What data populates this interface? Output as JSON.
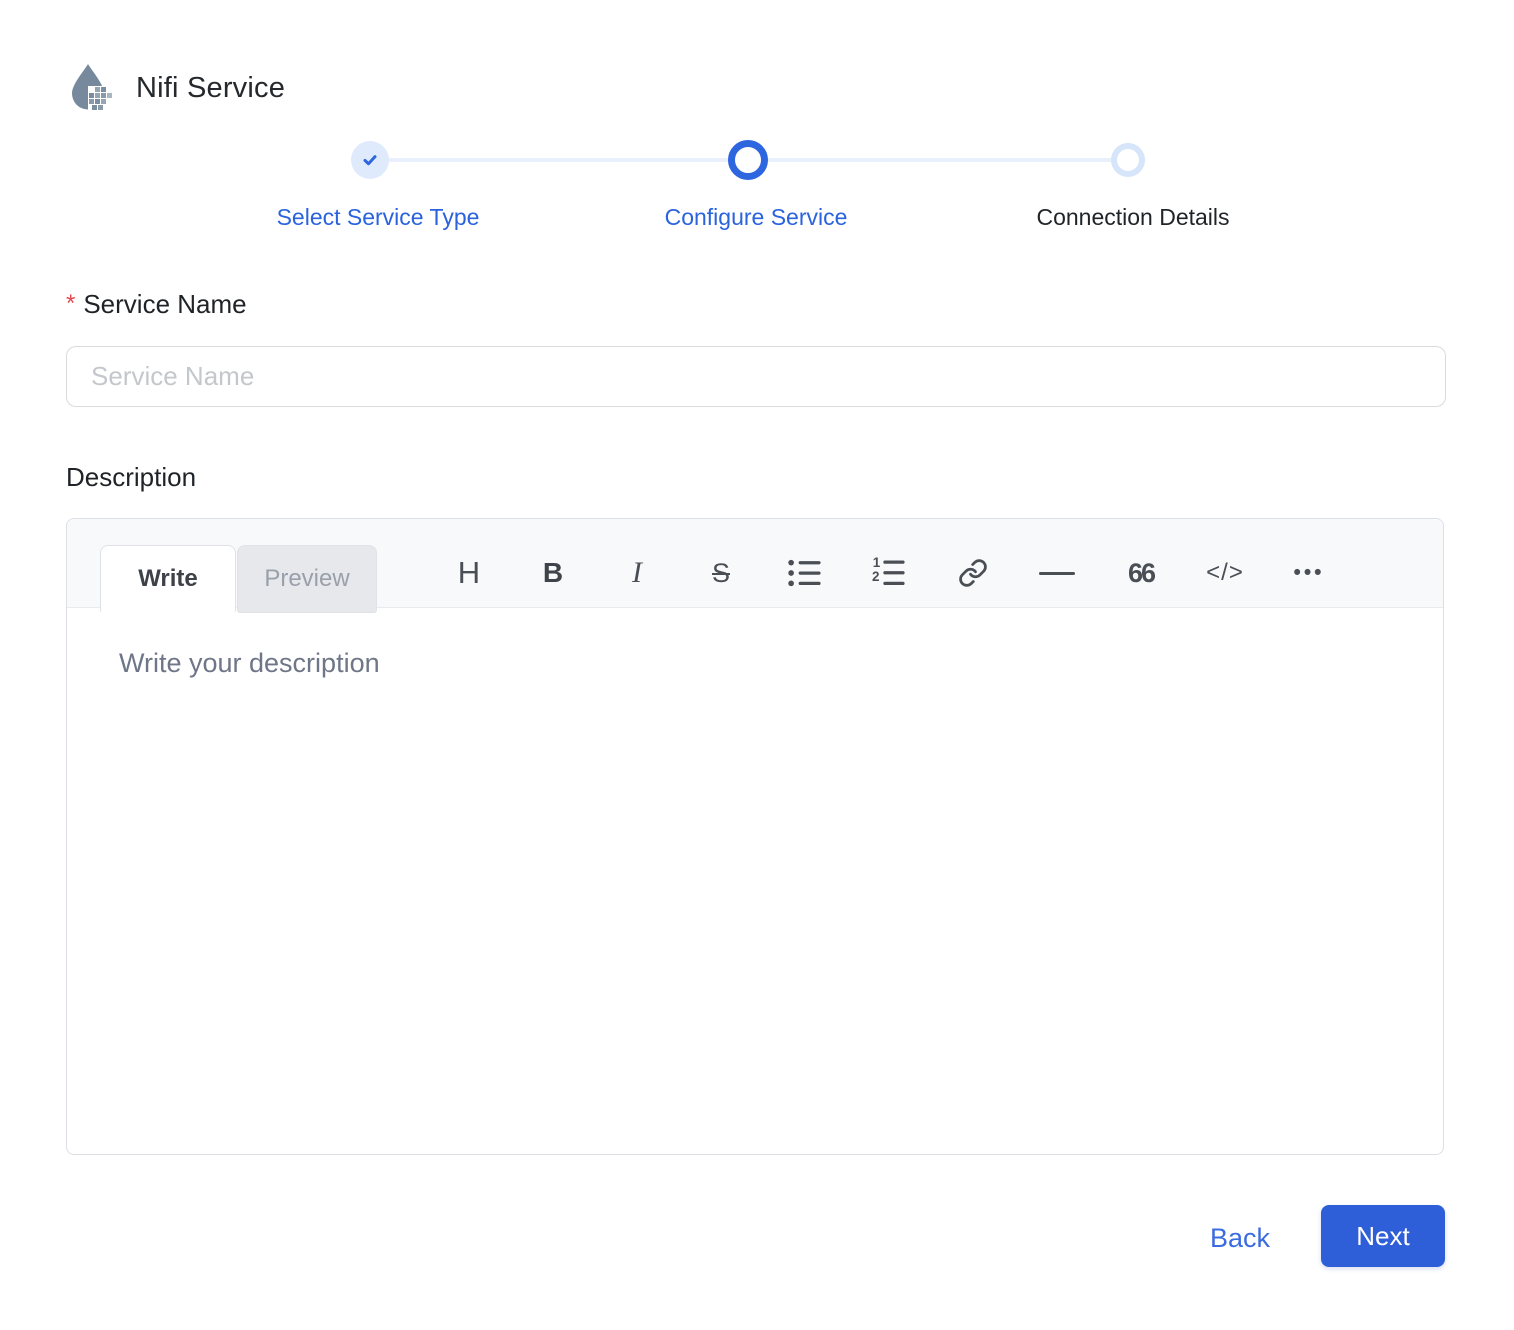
{
  "header": {
    "title": "Nifi Service",
    "icon": "nifi-droplet-icon"
  },
  "stepper": {
    "steps": [
      {
        "label": "Select Service Type",
        "state": "completed"
      },
      {
        "label": "Configure Service",
        "state": "active"
      },
      {
        "label": "Connection Details",
        "state": "upcoming"
      }
    ]
  },
  "form": {
    "service_name": {
      "required_marker": "*",
      "label": "Service Name",
      "placeholder": "Service Name",
      "value": ""
    },
    "description": {
      "label": "Description",
      "editor": {
        "tabs": [
          {
            "label": "Write",
            "active": true
          },
          {
            "label": "Preview",
            "active": false
          }
        ],
        "toolbar_icons": [
          "heading",
          "bold",
          "italic",
          "strikethrough",
          "bulleted-list",
          "numbered-list",
          "link",
          "horizontal-rule",
          "quote",
          "code",
          "more"
        ],
        "glyphs": {
          "heading": "H",
          "bold": "B",
          "italic": "I",
          "strikethrough": "S",
          "quote": "66",
          "code": "</>",
          "more": "•••"
        },
        "placeholder": "Write your description",
        "value": ""
      }
    }
  },
  "footer": {
    "back_label": "Back",
    "next_label": "Next"
  },
  "colors": {
    "primary_blue": "#2a63dd",
    "active_ring": "#2d66de",
    "completed_circle_bg": "#dfeafc",
    "upcoming_ring": "#d7e5fa",
    "connector_line": "#e9f0fc",
    "next_button_bg": "#2e5fd9",
    "required_asterisk": "#e5484d",
    "icon_slate": "#76899d"
  }
}
